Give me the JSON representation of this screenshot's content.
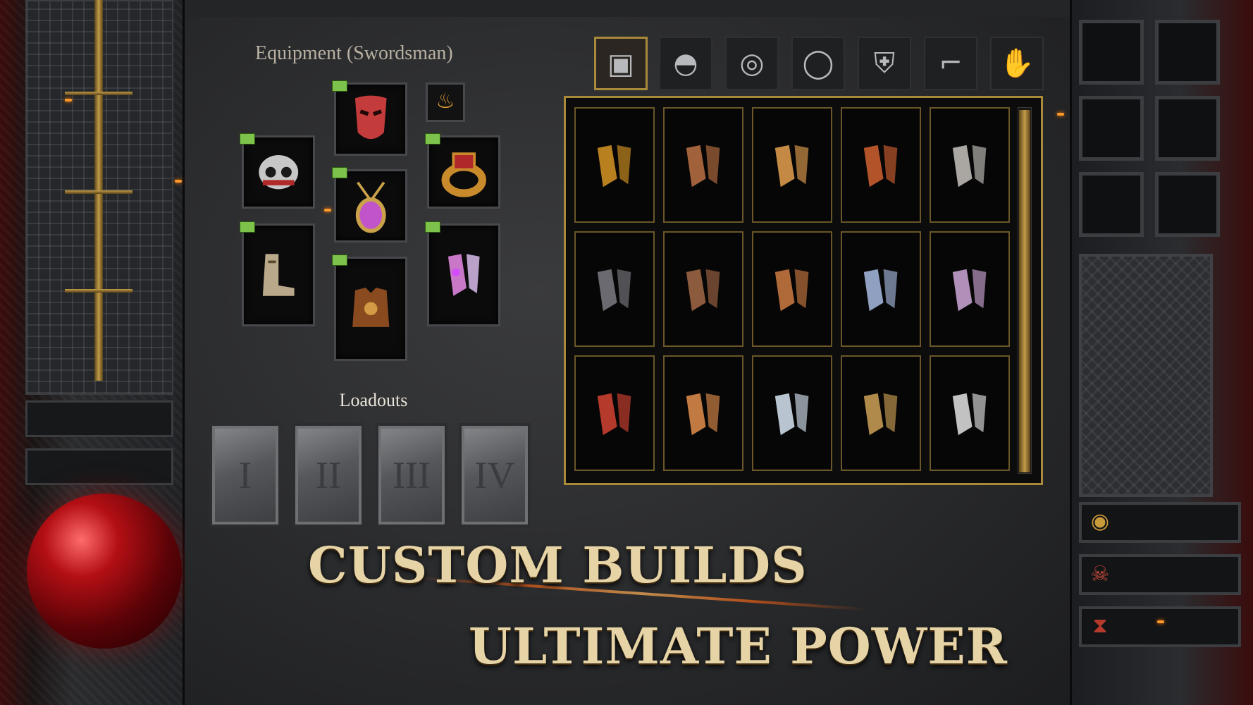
{
  "equipment": {
    "title": "Equipment (Swordsman)",
    "slots": [
      {
        "icon": "mask-icon",
        "color": "#c43b3b"
      },
      {
        "icon": "flame-icon",
        "color": "#e8a336"
      },
      {
        "icon": "skull-helmet-icon",
        "color": "#c7c7c7"
      },
      {
        "icon": "amulet-icon",
        "color": "#c254c9"
      },
      {
        "icon": "ring-icon",
        "color": "#c98a2b"
      },
      {
        "icon": "boots-icon",
        "color": "#b9a88a"
      },
      {
        "icon": "chest-armor-icon",
        "color": "#8a4a1f"
      },
      {
        "icon": "gloves-icon",
        "color": "#c977c7"
      }
    ]
  },
  "loadouts": {
    "title": "Loadouts",
    "items": [
      "I",
      "II",
      "III",
      "IV"
    ]
  },
  "tabs": [
    {
      "name": "chest-tab",
      "glyph": "▣",
      "active": true
    },
    {
      "name": "helmet-tab",
      "glyph": "◓"
    },
    {
      "name": "amulet-tab",
      "glyph": "◎"
    },
    {
      "name": "ring-tab",
      "glyph": "◯"
    },
    {
      "name": "armor-tab",
      "glyph": "⛨"
    },
    {
      "name": "boots-tab",
      "glyph": "⌐"
    },
    {
      "name": "gloves-tab",
      "glyph": "✋"
    }
  ],
  "inventory": {
    "rows": [
      [
        {
          "icon": "bracelet-icon",
          "color": "#b9801f"
        },
        {
          "icon": "gloves-icon",
          "color": "#a1613a"
        },
        {
          "icon": "gauntlet-icon",
          "color": "#c48a45"
        },
        {
          "icon": "leather-glove-icon",
          "color": "#b2532a"
        },
        {
          "icon": "steel-gauntlet-icon",
          "color": "#aaa7a2"
        }
      ],
      [
        {
          "icon": "dark-gloves-icon",
          "color": "#6a6a70"
        },
        {
          "icon": "hand-wrap-icon",
          "color": "#8c5a3c"
        },
        {
          "icon": "patterned-gloves-icon",
          "color": "#b06a3a"
        },
        {
          "icon": "blue-gauntlet-icon",
          "color": "#8fa0c0"
        },
        {
          "icon": "spiked-gauntlet-icon",
          "color": "#b08fb8"
        }
      ],
      [
        {
          "icon": "bloody-wraps-icon",
          "color": "#b53a2b"
        },
        {
          "icon": "bronze-ring-icon",
          "color": "#c27a43"
        },
        {
          "icon": "silver-ring-icon",
          "color": "#b8c4cf"
        },
        {
          "icon": "flower-ring-icon",
          "color": "#b08a4a"
        },
        {
          "icon": "knight-boots-icon",
          "color": "#c2c2c2"
        }
      ]
    ]
  },
  "headline": {
    "line1": "CUSTOM BUILDS",
    "line2": "ULTIMATE POWER"
  },
  "colors": {
    "gold": "#a98a3b",
    "headline": "#e6d3a6",
    "frame": "#47484b"
  }
}
